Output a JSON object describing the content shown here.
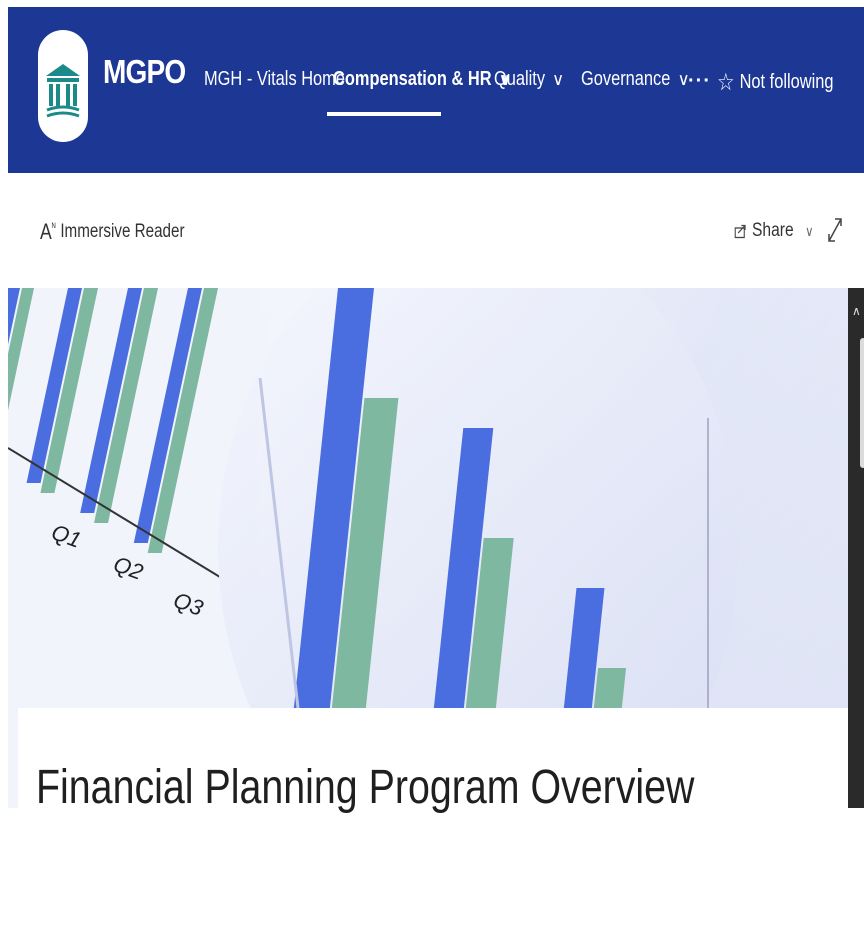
{
  "site": {
    "title": "MGPO",
    "logo_icon": "building-columns-icon"
  },
  "nav": {
    "items": [
      {
        "label": "MGH - Vitals Home",
        "has_dropdown": false,
        "active": false
      },
      {
        "label": "Compensation & HR",
        "has_dropdown": true,
        "active": true
      },
      {
        "label": "Quality",
        "has_dropdown": true,
        "active": false
      },
      {
        "label": "Governance",
        "has_dropdown": true,
        "active": false
      }
    ],
    "more_label": "···",
    "follow_label": "Not following",
    "follow_icon": "star-outline-icon"
  },
  "command_bar": {
    "immersive_reader_label": "Immersive Reader",
    "share_label": "Share",
    "expand_icon": "expand-icon"
  },
  "hero": {
    "quarter_labels": [
      "Q1",
      "Q2",
      "Q3"
    ]
  },
  "page": {
    "title": "Financial Planning Program Overview"
  },
  "colors": {
    "header_bg": "#1c3794",
    "logo_teal": "#1d8a8a",
    "bar_blue": "#4a6ee0",
    "bar_green": "#7fb8a0"
  }
}
